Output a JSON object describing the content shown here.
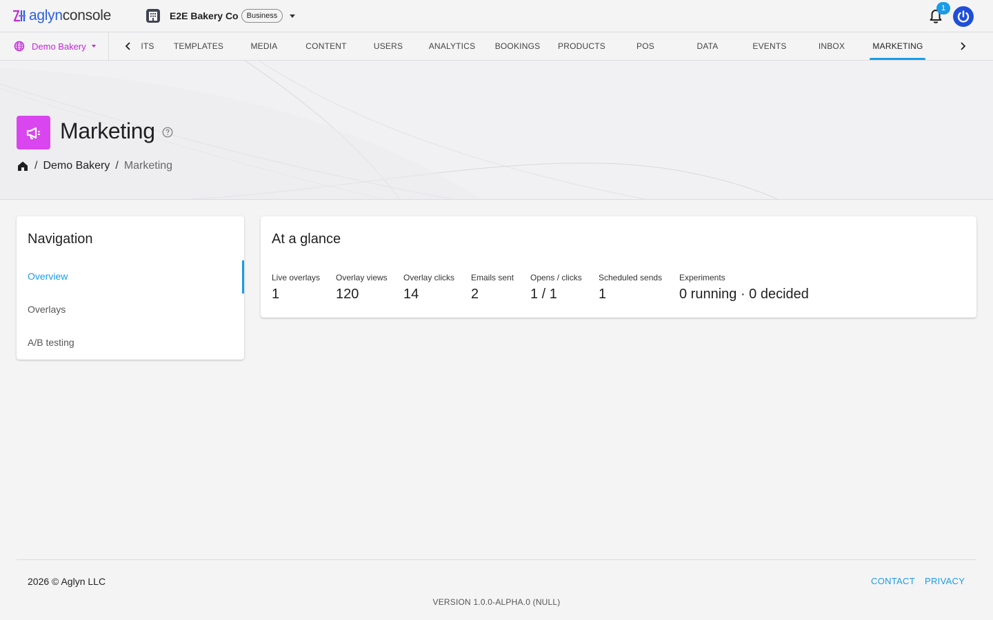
{
  "header": {
    "logo_brand": "aglyn",
    "logo_product": "console",
    "org_name": "E2E Bakery Co",
    "org_badge": "Business",
    "notification_count": "1"
  },
  "nav": {
    "site_label": "Demo Bakery",
    "tabs": [
      "ITS",
      "TEMPLATES",
      "MEDIA",
      "CONTENT",
      "USERS",
      "ANALYTICS",
      "BOOKINGS",
      "PRODUCTS",
      "POS",
      "DATA",
      "EVENTS",
      "INBOX",
      "MARKETING"
    ],
    "active_tab": "MARKETING"
  },
  "page": {
    "title": "Marketing",
    "breadcrumb": [
      "Demo Bakery",
      "Marketing"
    ]
  },
  "sidebar": {
    "title": "Navigation",
    "items": [
      "Overview",
      "Overlays",
      "A/B testing"
    ],
    "active": "Overview"
  },
  "glance": {
    "title": "At a glance",
    "stats": [
      {
        "label": "Live overlays",
        "value": "1"
      },
      {
        "label": "Overlay views",
        "value": "120"
      },
      {
        "label": "Overlay clicks",
        "value": "14"
      },
      {
        "label": "Emails sent",
        "value": "2"
      },
      {
        "label": "Opens / clicks",
        "value": "1 / 1"
      },
      {
        "label": "Scheduled sends",
        "value": "1"
      },
      {
        "label": "Experiments",
        "value": "0 running · 0 decided"
      }
    ]
  },
  "footer": {
    "copyright": "2026 © Aglyn LLC",
    "contact": "CONTACT",
    "privacy": "PRIVACY",
    "version": "VERSION 1.0.0-ALPHA.0 (NULL)"
  },
  "colors": {
    "accent": "#1a9be6",
    "brand": "#2b5fd9",
    "marketing": "#d946ef",
    "site": "#c026d3"
  }
}
